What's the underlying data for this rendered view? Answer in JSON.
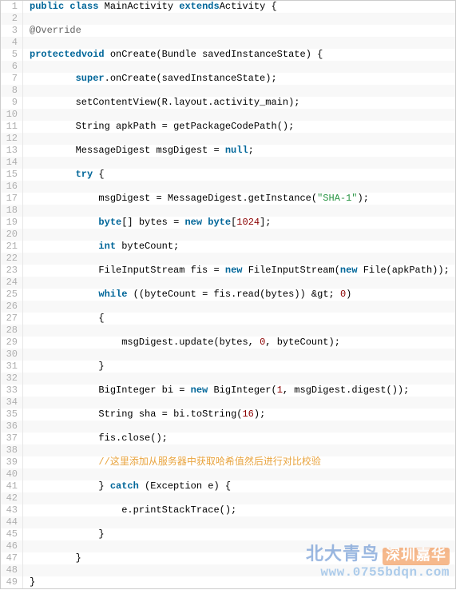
{
  "lines": [
    {
      "n": 1,
      "indent": 0,
      "tokens": [
        [
          "kw",
          "public"
        ],
        [
          "sp",
          " "
        ],
        [
          "kw",
          "class"
        ],
        [
          "sp",
          " "
        ],
        [
          "ident",
          "MainActivity"
        ],
        [
          "sp",
          " "
        ],
        [
          "kw",
          "extends"
        ],
        [
          "ident",
          "Activity"
        ],
        [
          "sp",
          " "
        ],
        [
          "punct",
          "{"
        ]
      ]
    },
    {
      "n": 2,
      "indent": 0,
      "tokens": []
    },
    {
      "n": 3,
      "indent": 0,
      "tokens": [
        [
          "ann",
          "@Override"
        ]
      ]
    },
    {
      "n": 4,
      "indent": 0,
      "tokens": []
    },
    {
      "n": 5,
      "indent": 0,
      "tokens": [
        [
          "kw",
          "protected"
        ],
        [
          "kw",
          "void"
        ],
        [
          "sp",
          " "
        ],
        [
          "ident",
          "onCreate"
        ],
        [
          "punct",
          "("
        ],
        [
          "ident",
          "Bundle"
        ],
        [
          "sp",
          " "
        ],
        [
          "ident",
          "savedInstanceState"
        ],
        [
          "punct",
          ")"
        ],
        [
          "sp",
          " "
        ],
        [
          "punct",
          "{"
        ]
      ]
    },
    {
      "n": 6,
      "indent": 0,
      "tokens": []
    },
    {
      "n": 7,
      "indent": 2,
      "tokens": [
        [
          "kw",
          "super"
        ],
        [
          "punct",
          "."
        ],
        [
          "ident",
          "onCreate"
        ],
        [
          "punct",
          "("
        ],
        [
          "ident",
          "savedInstanceState"
        ],
        [
          "punct",
          ");"
        ]
      ]
    },
    {
      "n": 8,
      "indent": 0,
      "tokens": []
    },
    {
      "n": 9,
      "indent": 2,
      "tokens": [
        [
          "ident",
          "setContentView"
        ],
        [
          "punct",
          "("
        ],
        [
          "ident",
          "R"
        ],
        [
          "punct",
          "."
        ],
        [
          "ident",
          "layout"
        ],
        [
          "punct",
          "."
        ],
        [
          "ident",
          "activity_main"
        ],
        [
          "punct",
          ");"
        ]
      ]
    },
    {
      "n": 10,
      "indent": 0,
      "tokens": []
    },
    {
      "n": 11,
      "indent": 2,
      "tokens": [
        [
          "ident",
          "String"
        ],
        [
          "sp",
          " "
        ],
        [
          "ident",
          "apkPath"
        ],
        [
          "sp",
          " "
        ],
        [
          "punct",
          "="
        ],
        [
          "sp",
          " "
        ],
        [
          "ident",
          "getPackageCodePath"
        ],
        [
          "punct",
          "();"
        ]
      ]
    },
    {
      "n": 12,
      "indent": 0,
      "tokens": []
    },
    {
      "n": 13,
      "indent": 2,
      "tokens": [
        [
          "ident",
          "MessageDigest"
        ],
        [
          "sp",
          " "
        ],
        [
          "ident",
          "msgDigest"
        ],
        [
          "sp",
          " "
        ],
        [
          "punct",
          "="
        ],
        [
          "sp",
          " "
        ],
        [
          "kw",
          "null"
        ],
        [
          "punct",
          ";"
        ]
      ]
    },
    {
      "n": 14,
      "indent": 0,
      "tokens": []
    },
    {
      "n": 15,
      "indent": 2,
      "tokens": [
        [
          "kw",
          "try"
        ],
        [
          "sp",
          " "
        ],
        [
          "punct",
          "{"
        ]
      ]
    },
    {
      "n": 16,
      "indent": 0,
      "tokens": []
    },
    {
      "n": 17,
      "indent": 3,
      "tokens": [
        [
          "ident",
          "msgDigest"
        ],
        [
          "sp",
          " "
        ],
        [
          "punct",
          "="
        ],
        [
          "sp",
          " "
        ],
        [
          "ident",
          "MessageDigest"
        ],
        [
          "punct",
          "."
        ],
        [
          "ident",
          "getInstance"
        ],
        [
          "punct",
          "("
        ],
        [
          "str",
          "\"SHA-1\""
        ],
        [
          "punct",
          ");"
        ]
      ]
    },
    {
      "n": 18,
      "indent": 0,
      "tokens": []
    },
    {
      "n": 19,
      "indent": 3,
      "tokens": [
        [
          "kw",
          "byte"
        ],
        [
          "punct",
          "[]"
        ],
        [
          "sp",
          " "
        ],
        [
          "ident",
          "bytes"
        ],
        [
          "sp",
          " "
        ],
        [
          "punct",
          "="
        ],
        [
          "sp",
          " "
        ],
        [
          "kw",
          "new"
        ],
        [
          "sp",
          " "
        ],
        [
          "kw",
          "byte"
        ],
        [
          "punct",
          "["
        ],
        [
          "num",
          "1024"
        ],
        [
          "punct",
          "];"
        ]
      ]
    },
    {
      "n": 20,
      "indent": 0,
      "tokens": []
    },
    {
      "n": 21,
      "indent": 3,
      "tokens": [
        [
          "kw",
          "int"
        ],
        [
          "sp",
          " "
        ],
        [
          "ident",
          "byteCount"
        ],
        [
          "punct",
          ";"
        ]
      ]
    },
    {
      "n": 22,
      "indent": 0,
      "tokens": []
    },
    {
      "n": 23,
      "indent": 3,
      "tokens": [
        [
          "ident",
          "FileInputStream"
        ],
        [
          "sp",
          " "
        ],
        [
          "ident",
          "fis"
        ],
        [
          "sp",
          " "
        ],
        [
          "punct",
          "="
        ],
        [
          "sp",
          " "
        ],
        [
          "kw",
          "new"
        ],
        [
          "sp",
          " "
        ],
        [
          "ident",
          "FileInputStream"
        ],
        [
          "punct",
          "("
        ],
        [
          "kw",
          "new"
        ],
        [
          "sp",
          " "
        ],
        [
          "ident",
          "File"
        ],
        [
          "punct",
          "("
        ],
        [
          "ident",
          "apkPath"
        ],
        [
          "punct",
          "));"
        ]
      ]
    },
    {
      "n": 24,
      "indent": 0,
      "tokens": []
    },
    {
      "n": 25,
      "indent": 3,
      "tokens": [
        [
          "kw",
          "while"
        ],
        [
          "sp",
          " "
        ],
        [
          "punct",
          "(("
        ],
        [
          "ident",
          "byteCount"
        ],
        [
          "sp",
          " "
        ],
        [
          "punct",
          "="
        ],
        [
          "sp",
          " "
        ],
        [
          "ident",
          "fis"
        ],
        [
          "punct",
          "."
        ],
        [
          "ident",
          "read"
        ],
        [
          "punct",
          "("
        ],
        [
          "ident",
          "bytes"
        ],
        [
          "punct",
          "))"
        ],
        [
          "sp",
          " "
        ],
        [
          "ident",
          "&gt;"
        ],
        [
          "sp",
          " "
        ],
        [
          "num",
          "0"
        ],
        [
          "punct",
          ")"
        ]
      ]
    },
    {
      "n": 26,
      "indent": 0,
      "tokens": []
    },
    {
      "n": 27,
      "indent": 3,
      "tokens": [
        [
          "punct",
          "{"
        ]
      ]
    },
    {
      "n": 28,
      "indent": 0,
      "tokens": []
    },
    {
      "n": 29,
      "indent": 4,
      "tokens": [
        [
          "ident",
          "msgDigest"
        ],
        [
          "punct",
          "."
        ],
        [
          "ident",
          "update"
        ],
        [
          "punct",
          "("
        ],
        [
          "ident",
          "bytes"
        ],
        [
          "punct",
          ","
        ],
        [
          "sp",
          " "
        ],
        [
          "num",
          "0"
        ],
        [
          "punct",
          ","
        ],
        [
          "sp",
          " "
        ],
        [
          "ident",
          "byteCount"
        ],
        [
          "punct",
          ");"
        ]
      ]
    },
    {
      "n": 30,
      "indent": 0,
      "tokens": []
    },
    {
      "n": 31,
      "indent": 3,
      "tokens": [
        [
          "punct",
          "}"
        ]
      ]
    },
    {
      "n": 32,
      "indent": 0,
      "tokens": []
    },
    {
      "n": 33,
      "indent": 3,
      "tokens": [
        [
          "ident",
          "BigInteger"
        ],
        [
          "sp",
          " "
        ],
        [
          "ident",
          "bi"
        ],
        [
          "sp",
          " "
        ],
        [
          "punct",
          "="
        ],
        [
          "sp",
          " "
        ],
        [
          "kw",
          "new"
        ],
        [
          "sp",
          " "
        ],
        [
          "ident",
          "BigInteger"
        ],
        [
          "punct",
          "("
        ],
        [
          "num",
          "1"
        ],
        [
          "punct",
          ","
        ],
        [
          "sp",
          " "
        ],
        [
          "ident",
          "msgDigest"
        ],
        [
          "punct",
          "."
        ],
        [
          "ident",
          "digest"
        ],
        [
          "punct",
          "());"
        ]
      ]
    },
    {
      "n": 34,
      "indent": 0,
      "tokens": []
    },
    {
      "n": 35,
      "indent": 3,
      "tokens": [
        [
          "ident",
          "String"
        ],
        [
          "sp",
          " "
        ],
        [
          "ident",
          "sha"
        ],
        [
          "sp",
          " "
        ],
        [
          "punct",
          "="
        ],
        [
          "sp",
          " "
        ],
        [
          "ident",
          "bi"
        ],
        [
          "punct",
          "."
        ],
        [
          "ident",
          "toString"
        ],
        [
          "punct",
          "("
        ],
        [
          "num",
          "16"
        ],
        [
          "punct",
          ");"
        ]
      ]
    },
    {
      "n": 36,
      "indent": 0,
      "tokens": []
    },
    {
      "n": 37,
      "indent": 3,
      "tokens": [
        [
          "ident",
          "fis"
        ],
        [
          "punct",
          "."
        ],
        [
          "ident",
          "close"
        ],
        [
          "punct",
          "();"
        ]
      ]
    },
    {
      "n": 38,
      "indent": 0,
      "tokens": []
    },
    {
      "n": 39,
      "indent": 3,
      "tokens": [
        [
          "comment",
          "//这里添加从服务器中获取哈希值然后进行对比校验"
        ]
      ]
    },
    {
      "n": 40,
      "indent": 0,
      "tokens": []
    },
    {
      "n": 41,
      "indent": 3,
      "tokens": [
        [
          "punct",
          "}"
        ],
        [
          "sp",
          " "
        ],
        [
          "kw",
          "catch"
        ],
        [
          "sp",
          " "
        ],
        [
          "punct",
          "("
        ],
        [
          "ident",
          "Exception"
        ],
        [
          "sp",
          " "
        ],
        [
          "ident",
          "e"
        ],
        [
          "punct",
          ")"
        ],
        [
          "sp",
          " "
        ],
        [
          "punct",
          "{"
        ]
      ]
    },
    {
      "n": 42,
      "indent": 0,
      "tokens": []
    },
    {
      "n": 43,
      "indent": 4,
      "tokens": [
        [
          "ident",
          "e"
        ],
        [
          "punct",
          "."
        ],
        [
          "ident",
          "printStackTrace"
        ],
        [
          "punct",
          "();"
        ]
      ]
    },
    {
      "n": 44,
      "indent": 0,
      "tokens": []
    },
    {
      "n": 45,
      "indent": 3,
      "tokens": [
        [
          "punct",
          "}"
        ]
      ]
    },
    {
      "n": 46,
      "indent": 0,
      "tokens": []
    },
    {
      "n": 47,
      "indent": 2,
      "tokens": [
        [
          "punct",
          "}"
        ]
      ]
    },
    {
      "n": 48,
      "indent": 0,
      "tokens": []
    },
    {
      "n": 49,
      "indent": 0,
      "tokens": [
        [
          "punct",
          "}"
        ]
      ]
    }
  ],
  "watermark": {
    "title_blue": "北大青鸟",
    "title_orange": "深圳嘉华",
    "url": "www.0755bdqn.com"
  }
}
